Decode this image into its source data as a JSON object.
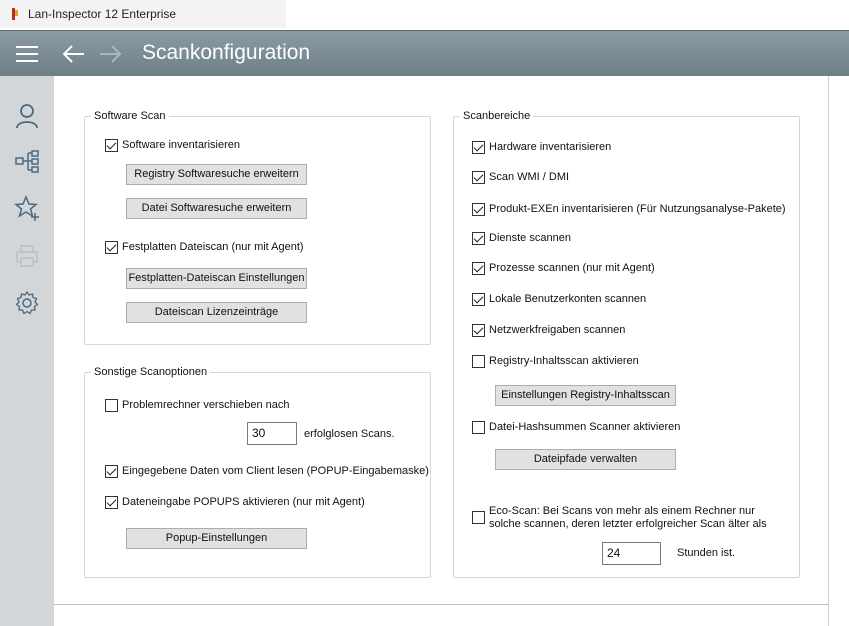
{
  "window": {
    "title": "Lan-Inspector 12 Enterprise"
  },
  "header": {
    "title": "Scankonfiguration"
  },
  "sidebar": {
    "items": [
      {
        "icon": "user-icon"
      },
      {
        "icon": "network-tree-icon"
      },
      {
        "icon": "star-add-icon"
      },
      {
        "icon": "printer-icon"
      },
      {
        "icon": "gear-icon"
      }
    ]
  },
  "software_scan": {
    "title": "Software Scan",
    "software_inventory": {
      "label": "Software inventarisieren",
      "checked": true
    },
    "registry_search_button": "Registry Softwaresuche erweitern",
    "file_search_button": "Datei Softwaresuche erweitern",
    "disk_filescan": {
      "label": "Festplatten Dateiscan (nur mit Agent)",
      "checked": true
    },
    "disk_filescan_settings_button": "Festplatten-Dateiscan Einstellungen",
    "filescan_license_button": "Dateiscan Lizenzeinträge"
  },
  "other_options": {
    "title": "Sonstige Scanoptionen",
    "move_problem_computers": {
      "label": "Problemrechner verschieben nach",
      "checked": false
    },
    "failed_scans_value": "30",
    "failed_scans_label": "erfolglosen Scans.",
    "read_client_data": {
      "label": "Eingegebene Daten vom Client lesen (POPUP-Eingabemaske)",
      "checked": true
    },
    "enable_popups": {
      "label": "Dateneingabe POPUPS aktivieren (nur mit Agent)",
      "checked": true
    },
    "popup_settings_button": "Popup-Einstellungen"
  },
  "scan_areas": {
    "title": "Scanbereiche",
    "items": [
      {
        "label": "Hardware inventarisieren",
        "checked": true
      },
      {
        "label": "Scan WMI / DMI",
        "checked": true
      },
      {
        "label": "Produkt-EXEn inventarisieren (Für Nutzungsanalyse-Pakete)",
        "checked": true
      },
      {
        "label": "Dienste scannen",
        "checked": true
      },
      {
        "label": "Prozesse scannen (nur mit Agent)",
        "checked": true
      },
      {
        "label": "Lokale Benutzerkonten scannen",
        "checked": true
      },
      {
        "label": "Netzwerkfreigaben scannen",
        "checked": true
      },
      {
        "label": "Registry-Inhaltsscan aktivieren",
        "checked": false
      }
    ],
    "registry_settings_button": "Einstellungen Registry-Inhaltsscan",
    "hash_scanner": {
      "label": "Datei-Hashsummen Scanner aktivieren",
      "checked": false
    },
    "file_paths_button": "Dateipfade verwalten",
    "eco_scan": {
      "label": "Eco-Scan: Bei Scans von mehr als einem Rechner nur solche scannen, deren letzter erfolgreicher Scan älter als",
      "checked": false
    },
    "eco_hours_value": "24",
    "eco_hours_label": "Stunden ist."
  }
}
